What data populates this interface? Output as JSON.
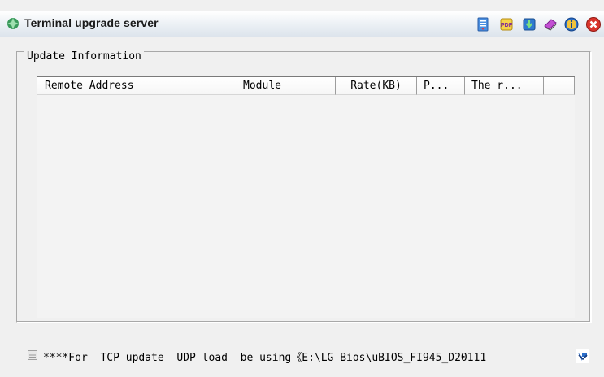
{
  "window": {
    "title": "Terminal upgrade server",
    "toolbar_icons": [
      "document-icon",
      "pdf-icon",
      "download-icon",
      "book-icon",
      "info-icon",
      "close-icon"
    ]
  },
  "group": {
    "label": "Update Information"
  },
  "list": {
    "columns": [
      "Remote Address",
      "Module",
      "Rate(KB)",
      "P...",
      "The r...",
      ""
    ],
    "rows": []
  },
  "status": {
    "text": "****For  TCP update  UDP load  be using《E:\\LG Bios\\uBIOS_FI945_D20111"
  },
  "colors": {
    "close_red": "#d9342b",
    "info_blue": "#2b6ec9",
    "title_icon_green": "#3a9a5c"
  }
}
